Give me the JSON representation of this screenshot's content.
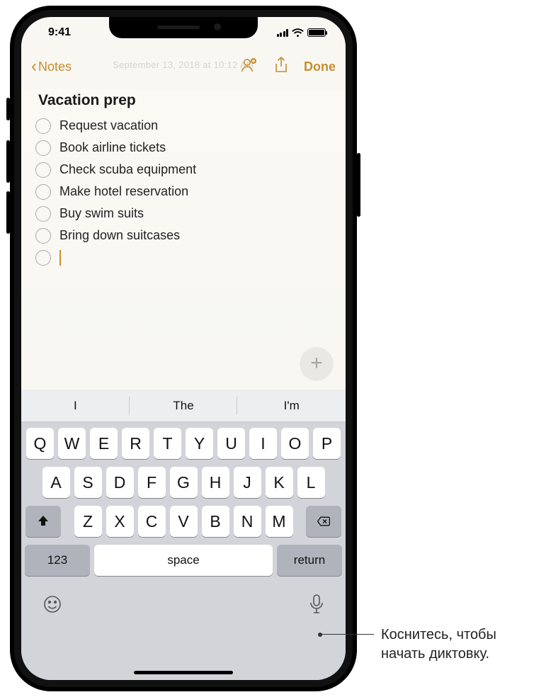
{
  "status": {
    "time": "9:41"
  },
  "nav": {
    "back_label": "Notes",
    "done_label": "Done",
    "ghost_date": "September 13, 2018 at 10:12 AM"
  },
  "note": {
    "title": "Vacation prep",
    "items": [
      "Request vacation",
      "Book airline tickets",
      "Check scuba equipment",
      "Make hotel reservation",
      "Buy swim suits",
      "Bring down suitcases"
    ]
  },
  "suggestions": [
    "I",
    "The",
    "I'm"
  ],
  "keyboard": {
    "row1": [
      "Q",
      "W",
      "E",
      "R",
      "T",
      "Y",
      "U",
      "I",
      "O",
      "P"
    ],
    "row2": [
      "A",
      "S",
      "D",
      "F",
      "G",
      "H",
      "J",
      "K",
      "L"
    ],
    "row3": [
      "Z",
      "X",
      "C",
      "V",
      "B",
      "N",
      "M"
    ],
    "numkey": "123",
    "space": "space",
    "return": "return"
  },
  "callout": "Коснитесь, чтобы начать диктовку."
}
